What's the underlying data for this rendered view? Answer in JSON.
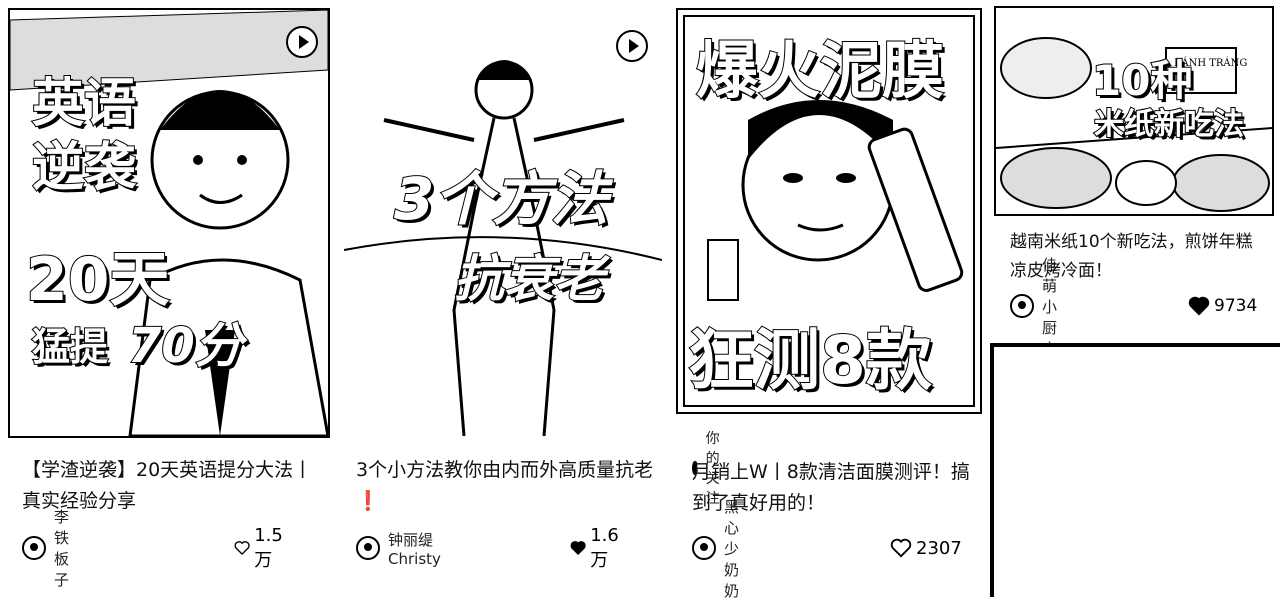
{
  "cards": [
    {
      "cover_lines": [
        "英语",
        "逆袭",
        "20天",
        "猛提",
        "70分"
      ],
      "title": "【学渣逆袭】20天英语提分大法丨真实经验分享",
      "author": "李铁板子",
      "likes": "1.5万"
    },
    {
      "cover_lines": [
        "3个方法",
        "抗衰老"
      ],
      "title": "3个小方法教你由内而外高质量抗老❗",
      "author": "钟丽缇Christy",
      "likes": "1.6万"
    },
    {
      "cover_lines": [
        "爆火泥膜",
        "狂测8款"
      ],
      "follow_tag": "你的关注",
      "title": "月销上W丨8款清洁面膜测评！搞到了真好用的！",
      "author": "黑心少奶奶",
      "likes": "2307"
    },
    {
      "cover_lines": [
        "10种",
        "米纸新吃法"
      ],
      "cover_small_text": "BÁNH TRÁNG",
      "title": "越南米纸10个新吃法，煎饼年糕凉皮烤冷面！",
      "author": "佳萌小厨房",
      "likes": "9734"
    }
  ],
  "icons": {
    "play": "play-icon",
    "like": "heart-icon",
    "follow": "follow-icon"
  }
}
